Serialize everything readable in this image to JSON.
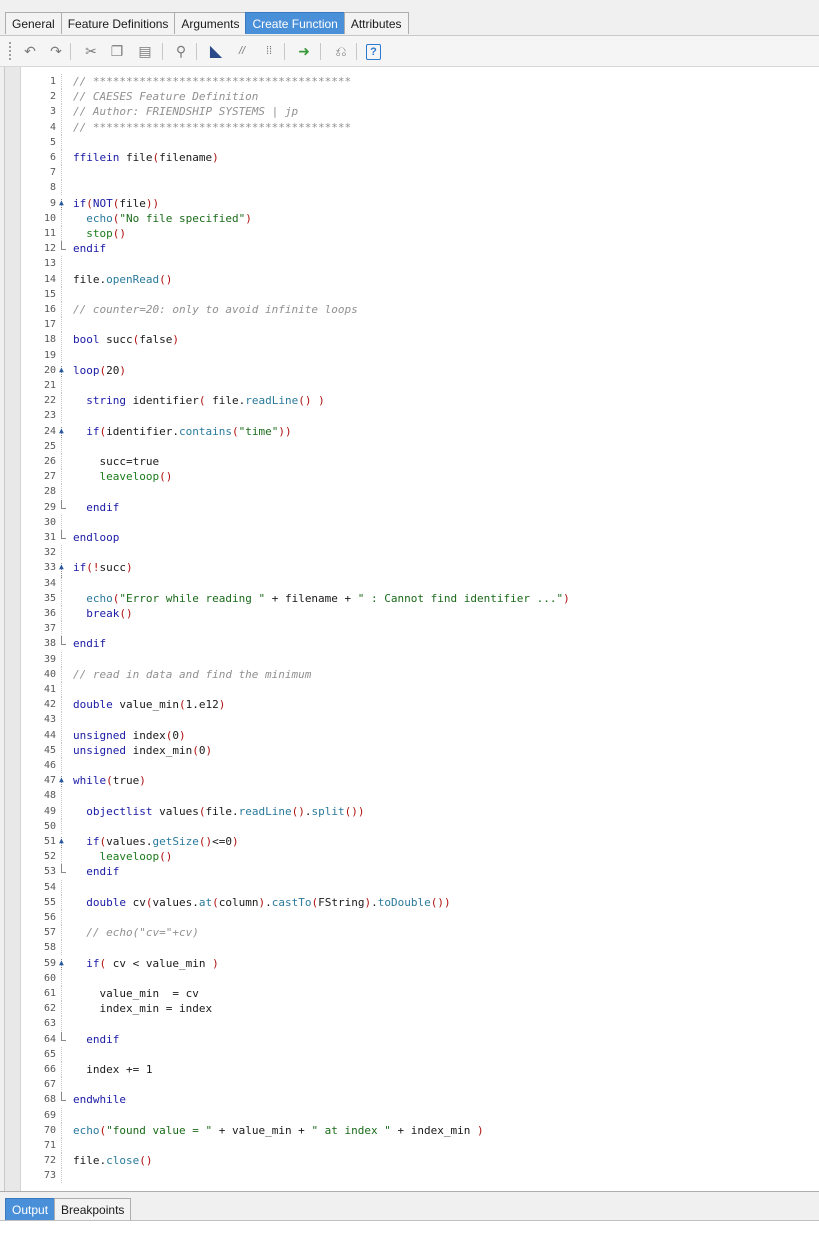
{
  "tabs": [
    {
      "label": "General",
      "active": false
    },
    {
      "label": "Feature Definitions",
      "active": false
    },
    {
      "label": "Arguments",
      "active": false
    },
    {
      "label": "Create Function",
      "active": true
    },
    {
      "label": "Attributes",
      "active": false
    }
  ],
  "toolbar": {
    "buttons": [
      {
        "name": "undo-icon",
        "glyph": "↶"
      },
      {
        "name": "redo-icon",
        "glyph": "↷"
      },
      {
        "name": "cut-icon",
        "glyph": "✂"
      },
      {
        "name": "copy-icon",
        "glyph": "❐"
      },
      {
        "name": "paste-icon",
        "glyph": "▤"
      },
      {
        "name": "find-icon",
        "glyph": "⚲"
      },
      {
        "name": "bookmark-icon",
        "glyph": "◣"
      },
      {
        "name": "comment-icon",
        "glyph": "//"
      },
      {
        "name": "uncomment-icon",
        "glyph": "⁞⁞"
      },
      {
        "name": "run-to-breakpoint-icon",
        "glyph": "➜"
      },
      {
        "name": "debug-icon",
        "glyph": "⎌"
      },
      {
        "name": "help-icon",
        "glyph": "?"
      }
    ]
  },
  "editor": {
    "lines": [
      [
        [
          "cm",
          "// ***************************************"
        ]
      ],
      [
        [
          "cm",
          "// CAESES Feature Definition"
        ]
      ],
      [
        [
          "cm",
          "// Author: FRIENDSHIP SYSTEMS | jp"
        ]
      ],
      [
        [
          "cm",
          "// ***************************************"
        ]
      ],
      [],
      [
        [
          "ty",
          "ffilein"
        ],
        [
          "df",
          " file"
        ],
        [
          "pn",
          "("
        ],
        [
          "df",
          "filename"
        ],
        [
          "pn",
          ")"
        ]
      ],
      [],
      [],
      [
        [
          "kw",
          "if"
        ],
        [
          "pn",
          "("
        ],
        [
          "kw",
          "NOT"
        ],
        [
          "pn",
          "("
        ],
        [
          "df",
          "file"
        ],
        [
          "pn",
          "))"
        ]
      ],
      [
        [
          "df",
          "  "
        ],
        [
          "fn",
          "echo"
        ],
        [
          "pn",
          "("
        ],
        [
          "st",
          "\"No file specified\""
        ],
        [
          "pn",
          ")"
        ]
      ],
      [
        [
          "df",
          "  "
        ],
        [
          "bn",
          "stop"
        ],
        [
          "pn",
          "()"
        ]
      ],
      [
        [
          "kw",
          "endif"
        ]
      ],
      [],
      [
        [
          "df",
          "file."
        ],
        [
          "fn",
          "openRead"
        ],
        [
          "pn",
          "()"
        ]
      ],
      [],
      [
        [
          "cm",
          "// counter=20: only to avoid infinite loops"
        ]
      ],
      [],
      [
        [
          "ty",
          "bool"
        ],
        [
          "df",
          " succ"
        ],
        [
          "pn",
          "("
        ],
        [
          "df",
          "false"
        ],
        [
          "pn",
          ")"
        ]
      ],
      [],
      [
        [
          "kw",
          "loop"
        ],
        [
          "pn",
          "("
        ],
        [
          "df",
          "20"
        ],
        [
          "pn",
          ")"
        ]
      ],
      [],
      [
        [
          "df",
          "  "
        ],
        [
          "ty",
          "string"
        ],
        [
          "df",
          " identifier"
        ],
        [
          "pn",
          "("
        ],
        [
          "df",
          " file."
        ],
        [
          "fn",
          "readLine"
        ],
        [
          "pn",
          "()"
        ],
        [
          "df",
          " "
        ],
        [
          "pn",
          ")"
        ]
      ],
      [],
      [
        [
          "df",
          "  "
        ],
        [
          "kw",
          "if"
        ],
        [
          "pn",
          "("
        ],
        [
          "df",
          "identifier."
        ],
        [
          "fn",
          "contains"
        ],
        [
          "pn",
          "("
        ],
        [
          "st",
          "\"time\""
        ],
        [
          "pn",
          "))"
        ]
      ],
      [],
      [
        [
          "df",
          "    succ=true"
        ]
      ],
      [
        [
          "df",
          "    "
        ],
        [
          "bn",
          "leaveloop"
        ],
        [
          "pn",
          "()"
        ]
      ],
      [],
      [
        [
          "df",
          "  "
        ],
        [
          "kw",
          "endif"
        ]
      ],
      [],
      [
        [
          "kw",
          "endloop"
        ]
      ],
      [],
      [
        [
          "kw",
          "if"
        ],
        [
          "pn",
          "("
        ],
        [
          "op",
          "!"
        ],
        [
          "df",
          "succ"
        ],
        [
          "pn",
          ")"
        ]
      ],
      [],
      [
        [
          "df",
          "  "
        ],
        [
          "fn",
          "echo"
        ],
        [
          "pn",
          "("
        ],
        [
          "st",
          "\"Error while reading \""
        ],
        [
          "df",
          " + filename + "
        ],
        [
          "st",
          "\" : Cannot find identifier ...\""
        ],
        [
          "pn",
          ")"
        ]
      ],
      [
        [
          "df",
          "  "
        ],
        [
          "kw",
          "break"
        ],
        [
          "pn",
          "()"
        ]
      ],
      [],
      [
        [
          "kw",
          "endif"
        ]
      ],
      [],
      [
        [
          "cm",
          "// read in data and find the minimum"
        ]
      ],
      [],
      [
        [
          "ty",
          "double"
        ],
        [
          "df",
          " value_min"
        ],
        [
          "pn",
          "("
        ],
        [
          "df",
          "1.e12"
        ],
        [
          "pn",
          ")"
        ]
      ],
      [],
      [
        [
          "ty",
          "unsigned"
        ],
        [
          "df",
          " index"
        ],
        [
          "pn",
          "("
        ],
        [
          "df",
          "0"
        ],
        [
          "pn",
          ")"
        ]
      ],
      [
        [
          "ty",
          "unsigned"
        ],
        [
          "df",
          " index_min"
        ],
        [
          "pn",
          "("
        ],
        [
          "df",
          "0"
        ],
        [
          "pn",
          ")"
        ]
      ],
      [],
      [
        [
          "kw",
          "while"
        ],
        [
          "pn",
          "("
        ],
        [
          "df",
          "true"
        ],
        [
          "pn",
          ")"
        ]
      ],
      [],
      [
        [
          "df",
          "  "
        ],
        [
          "ty",
          "objectlist"
        ],
        [
          "df",
          " values"
        ],
        [
          "pn",
          "("
        ],
        [
          "df",
          "file."
        ],
        [
          "fn",
          "readLine"
        ],
        [
          "pn",
          "()"
        ],
        [
          "df",
          "."
        ],
        [
          "fn",
          "split"
        ],
        [
          "pn",
          "())"
        ]
      ],
      [],
      [
        [
          "df",
          "  "
        ],
        [
          "kw",
          "if"
        ],
        [
          "pn",
          "("
        ],
        [
          "df",
          "values."
        ],
        [
          "fn",
          "getSize"
        ],
        [
          "pn",
          "()"
        ],
        [
          "df",
          "<=0"
        ],
        [
          "pn",
          ")"
        ]
      ],
      [
        [
          "df",
          "    "
        ],
        [
          "bn",
          "leaveloop"
        ],
        [
          "pn",
          "()"
        ]
      ],
      [
        [
          "df",
          "  "
        ],
        [
          "kw",
          "endif"
        ]
      ],
      [],
      [
        [
          "df",
          "  "
        ],
        [
          "ty",
          "double"
        ],
        [
          "df",
          " cv"
        ],
        [
          "pn",
          "("
        ],
        [
          "df",
          "values."
        ],
        [
          "fn",
          "at"
        ],
        [
          "pn",
          "("
        ],
        [
          "df",
          "column"
        ],
        [
          "pn",
          ")"
        ],
        [
          "df",
          "."
        ],
        [
          "fn",
          "castTo"
        ],
        [
          "pn",
          "("
        ],
        [
          "df",
          "FString"
        ],
        [
          "pn",
          ")"
        ],
        [
          "df",
          "."
        ],
        [
          "fn",
          "toDouble"
        ],
        [
          "pn",
          "())"
        ]
      ],
      [],
      [
        [
          "df",
          "  "
        ],
        [
          "cm",
          "// echo(\"cv=\"+cv)"
        ]
      ],
      [],
      [
        [
          "df",
          "  "
        ],
        [
          "kw",
          "if"
        ],
        [
          "pn",
          "("
        ],
        [
          "df",
          " cv < value_min "
        ],
        [
          "pn",
          ")"
        ]
      ],
      [],
      [
        [
          "df",
          "    value_min  = cv"
        ]
      ],
      [
        [
          "df",
          "    index_min = index"
        ]
      ],
      [],
      [
        [
          "df",
          "  "
        ],
        [
          "kw",
          "endif"
        ]
      ],
      [],
      [
        [
          "df",
          "  index += 1"
        ]
      ],
      [],
      [
        [
          "kw",
          "endwhile"
        ]
      ],
      [],
      [
        [
          "fn",
          "echo"
        ],
        [
          "pn",
          "("
        ],
        [
          "st",
          "\"found value = \""
        ],
        [
          "df",
          " + value_min + "
        ],
        [
          "st",
          "\" at index \""
        ],
        [
          "df",
          " + index_min "
        ],
        [
          "pn",
          ")"
        ]
      ],
      [],
      [
        [
          "df",
          "file."
        ],
        [
          "fn",
          "close"
        ],
        [
          "pn",
          "()"
        ]
      ],
      []
    ],
    "folds": [
      9,
      20,
      24,
      33,
      47,
      51,
      59
    ],
    "fold_ends": [
      12,
      29,
      31,
      38,
      53,
      64,
      68
    ]
  },
  "bottom_tabs": [
    {
      "label": "Output",
      "active": true
    },
    {
      "label": "Breakpoints",
      "active": false
    }
  ]
}
